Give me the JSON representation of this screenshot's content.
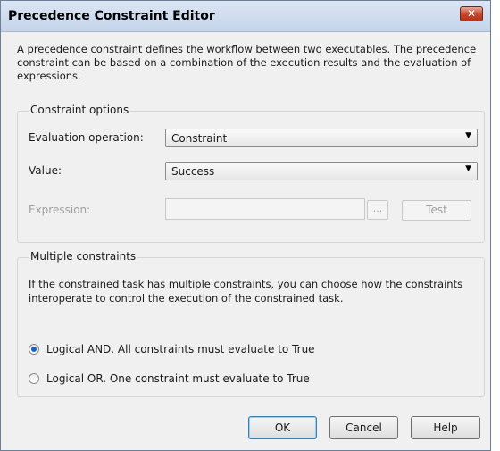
{
  "window": {
    "title": "Precedence Constraint Editor",
    "close_glyph": "✕"
  },
  "description": "A precedence constraint defines the workflow between two executables. The precedence constraint can be based on a combination of the execution results and the evaluation of expressions.",
  "constraint_options": {
    "legend": "Constraint options",
    "evaluation_operation": {
      "label": "Evaluation operation:",
      "value": "Constraint"
    },
    "value": {
      "label": "Value:",
      "value": "Success"
    },
    "expression": {
      "label": "Expression:",
      "value": "",
      "browse_label": "...",
      "test_label": "Test"
    }
  },
  "multiple_constraints": {
    "legend": "Multiple constraints",
    "description": "If the constrained task has multiple constraints, you can choose how the constraints interoperate to control the execution of the constrained task.",
    "options": [
      {
        "label": "Logical AND. All constraints must evaluate to True",
        "checked": true
      },
      {
        "label": "Logical OR. One constraint must evaluate to True",
        "checked": false
      }
    ]
  },
  "buttons": {
    "ok": "OK",
    "cancel": "Cancel",
    "help": "Help"
  },
  "icons": {
    "dropdown": "chevron-down-icon",
    "close": "close-icon"
  },
  "colors": {
    "radio_selected": "#1d5fc7",
    "close_button": "#c7452d"
  }
}
